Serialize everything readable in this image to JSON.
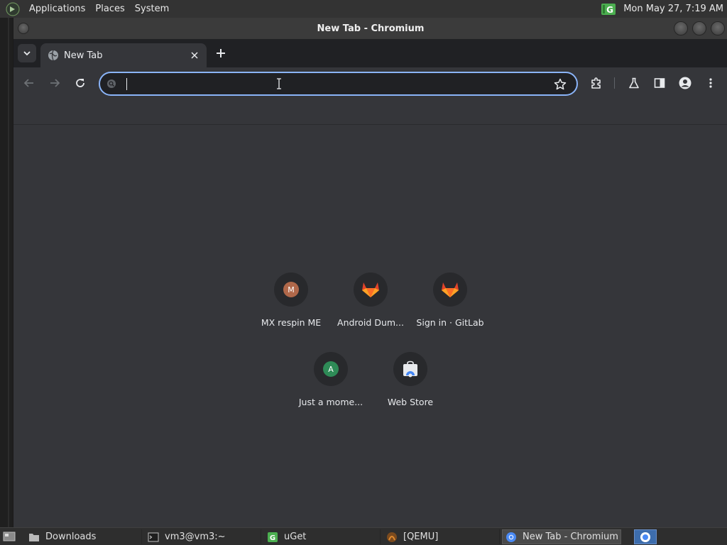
{
  "top_panel": {
    "menus": [
      "Applications",
      "Places",
      "System"
    ],
    "clock": "Mon May 27,  7:19 AM",
    "logo_icon": "mx-logo-icon",
    "tray_icon": "uget-tray-icon"
  },
  "window": {
    "title": "New Tab - Chromium"
  },
  "tabs": [
    {
      "label": "New Tab",
      "icon": "globe-icon"
    }
  ],
  "omnibox": {
    "value": "",
    "placeholder": ""
  },
  "shortcuts": [
    {
      "title": "MX respin ME",
      "letter": "M",
      "color": "#b0684a"
    },
    {
      "title": "Android Dum...",
      "icon": "gitlab-icon"
    },
    {
      "title": "Sign in · GitLab",
      "icon": "gitlab-icon"
    },
    {
      "title": "Just a mome...",
      "letter": "A",
      "color": "#2e8b57"
    },
    {
      "title": "Web Store",
      "icon": "webstore-icon"
    }
  ],
  "taskbar": {
    "tasks": [
      {
        "label": "Downloads",
        "icon": "folder-icon"
      },
      {
        "label": "vm3@vm3:~",
        "icon": "terminal-icon"
      },
      {
        "label": "uGet",
        "icon": "uget-icon"
      },
      {
        "label": "[QEMU]",
        "icon": "qemu-icon"
      },
      {
        "label": "New Tab - Chromium",
        "icon": "chromium-icon",
        "active": true
      }
    ]
  },
  "colors": {
    "accent": "#8ab4f8",
    "toolbar": "#35363a",
    "tabstrip": "#202124",
    "gitlab": "#e24329"
  }
}
